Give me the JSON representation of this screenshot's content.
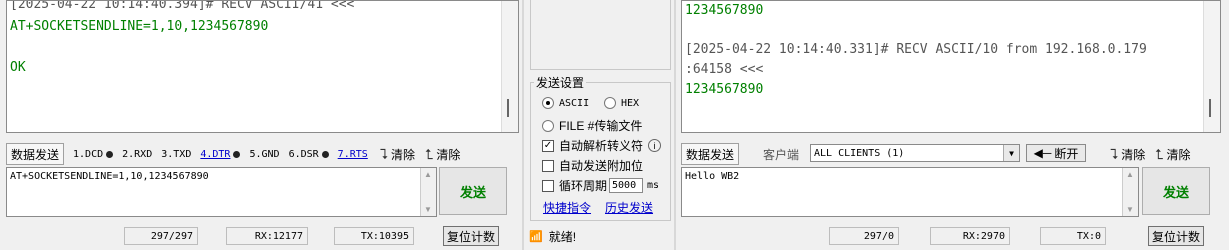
{
  "left": {
    "log": [
      {
        "text": "[2025-04-22 10:14:40.394]# RECV ASCII/41 <<<",
        "color": "gray"
      },
      {
        "text": "AT+SOCKETSENDLINE=1,10,1234567890",
        "color": "green"
      },
      {
        "text": "OK",
        "color": "green"
      }
    ],
    "send_tab": "数据发送",
    "signals": [
      {
        "label": "1.DCD",
        "dot": true,
        "link": false
      },
      {
        "label": "2.RXD",
        "dot": false,
        "link": false
      },
      {
        "label": "3.TXD",
        "dot": false,
        "link": false
      },
      {
        "label": "4.DTR",
        "dot": true,
        "link": true
      },
      {
        "label": "5.GND",
        "dot": false,
        "link": false
      },
      {
        "label": "6.DSR",
        "dot": true,
        "link": false
      },
      {
        "label": "7.RTS",
        "dot": false,
        "link": true
      }
    ],
    "clear1": "清除",
    "clear2": "清除",
    "input_text": "AT+SOCKETSENDLINE=1,10,1234567890",
    "send_label": "发送",
    "status": {
      "count": "297/297",
      "rx": "RX:12177",
      "tx": "TX:10395",
      "reset": "复位计数"
    }
  },
  "middle": {
    "group_title": "发送设置",
    "ascii": "ASCII",
    "hex": "HEX",
    "file": "FILE #传输文件",
    "auto_escape": "自动解析转义符",
    "auto_append": "自动发送附加位",
    "cycle": "循环周期",
    "cycle_value": "5000",
    "cycle_unit": "ms",
    "shortcut": "快捷指令",
    "history": "历史发送",
    "ready": "就绪!"
  },
  "right": {
    "log": [
      {
        "text": "1234567890",
        "color": "green"
      },
      {
        "text": "[2025-04-22 10:14:40.331]# RECV ASCII/10 from 192.168.0.179",
        "color": "gray"
      },
      {
        "text": ":64158 <<<",
        "color": "gray"
      },
      {
        "text": "1234567890",
        "color": "green"
      }
    ],
    "send_tab": "数据发送",
    "client_label": "客户端",
    "client_value": "ALL CLIENTS (1)",
    "disconnect": "断开",
    "clear1": "清除",
    "clear2": "清除",
    "input_text": "Hello WB2",
    "send_label": "发送",
    "status": {
      "count": "297/0",
      "rx": "RX:2970",
      "tx": "TX:0",
      "reset": "复位计数"
    }
  }
}
